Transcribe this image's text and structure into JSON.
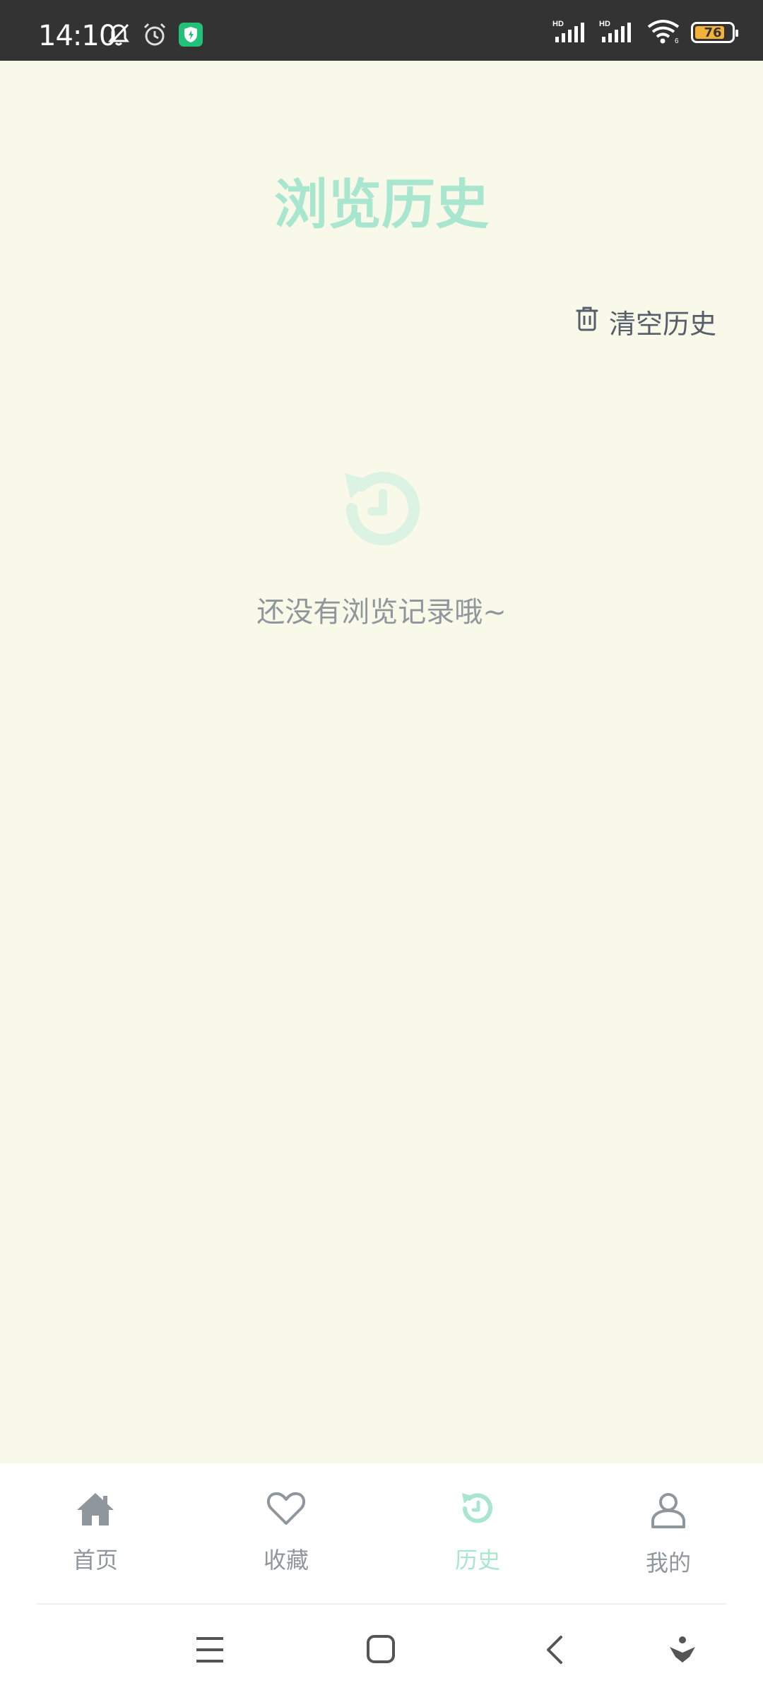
{
  "status_bar": {
    "time": "14:10",
    "icons": [
      "bell-off-icon",
      "alarm-icon",
      "shield-app-icon",
      "signal-hd-icon",
      "signal-hd-icon",
      "wifi-icon"
    ],
    "battery_level": "76",
    "battery_color": "#f2b23a"
  },
  "header": {
    "title": "浏览历史",
    "clear_label": "清空历史"
  },
  "empty_state": {
    "icon": "history-icon",
    "message": "还没有浏览记录哦~"
  },
  "bottom_nav": {
    "items": [
      {
        "label": "首页",
        "icon": "home-icon"
      },
      {
        "label": "收藏",
        "icon": "heart-icon"
      },
      {
        "label": "历史",
        "icon": "history-icon",
        "active": true
      },
      {
        "label": "我的",
        "icon": "user-icon"
      }
    ],
    "active_color": "#a9e6cf",
    "inactive_color": "#8f969c"
  },
  "system_nav": [
    "menu-icon",
    "home-square-icon",
    "back-icon",
    "assistant-icon"
  ],
  "colors": {
    "background": "#f8f9e8",
    "accent": "#a9e6cf",
    "status_bar": "#333333"
  }
}
